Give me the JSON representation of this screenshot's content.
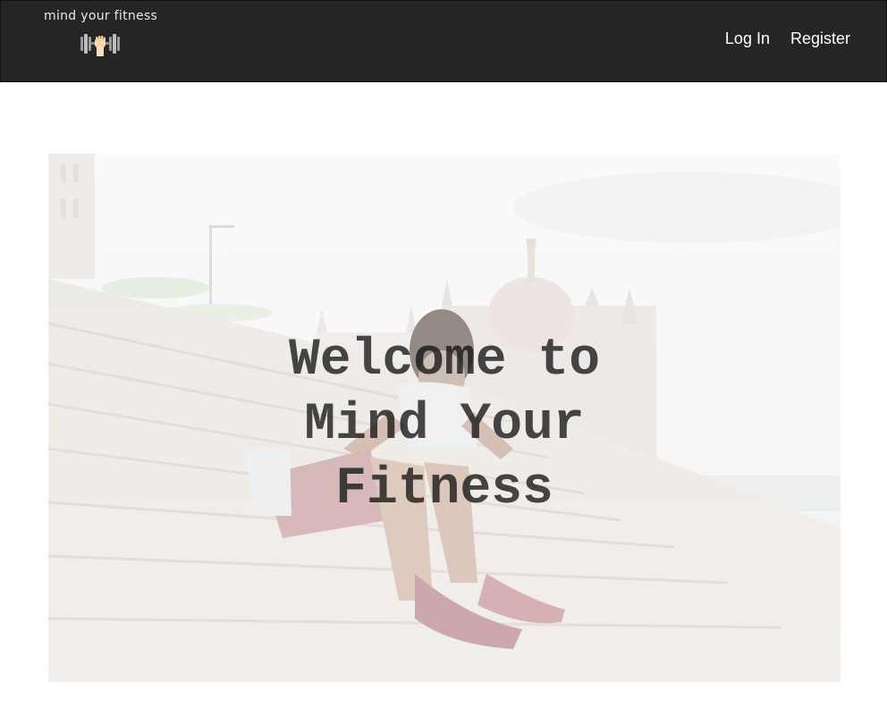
{
  "navbar": {
    "brand_text": "mind your fitness",
    "brand_icon": "dumbbell-fist-icon",
    "links": [
      {
        "label": "Log In"
      },
      {
        "label": "Register"
      }
    ]
  },
  "hero": {
    "title": "Welcome to\nMind Your\nFitness",
    "image_subject": "athlete-tying-shoes-on-stone-steps-photo"
  },
  "colors": {
    "navbar_bg": "#252525",
    "nav_text": "#ffffff",
    "page_bg": "#ffffff"
  }
}
